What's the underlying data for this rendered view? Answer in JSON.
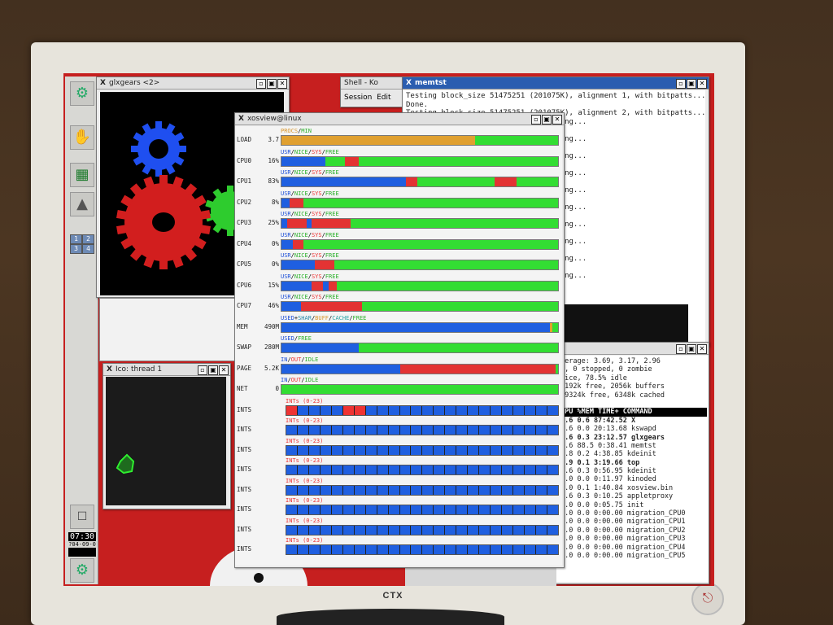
{
  "monitor": {
    "brand": "CTX"
  },
  "panel": {
    "pager": [
      "1",
      "2",
      "3",
      "4"
    ],
    "clock_time": "07:30",
    "clock_date": "?04-09-0"
  },
  "glxgears": {
    "title": "glxgears <2>"
  },
  "ico": {
    "title": "Ico: thread 1"
  },
  "shell": {
    "title": "Shell - Ko",
    "menu": [
      "Session",
      "Edit"
    ]
  },
  "memtst": {
    "title": "memtst",
    "lines": [
      "Testing block_size 51475251 (201075K), alignment 1, with bitpatts...Verifying...",
      "Done.",
      "Testing block_size 51475251 (201075K), alignment 2, with bitpatts...Verifying...",
      "                                        alignment 3, with bitpatts...Verifying...",
      "",
      "                                        alignment 0, with bitpatts...Verifying...",
      "",
      "                                        alignment 1, with bitpatts...Verifying...",
      "",
      "                                        alignment 2, with bitpatts...Verifying...",
      "",
      "                                        alignment 3, with bitpatts...Verifying...",
      "",
      "                                        alignment 0, with bitpatts...Verifying...",
      "",
      "                                        alignment 1, with bitpatts...Verifying...",
      "",
      "                                        alignment 2, with bitpatts...Verifying...",
      "",
      "                                        alignment 3, with bitpatts...Verifying...",
      "",
      "                                        alignment 0, with bitpatts...Verifying..."
    ]
  },
  "top": {
    "summary": [
      "verage: 3.69, 3.17, 2.96",
      "g,    0 stopped,    0 zombie",
      " nice,  78.5% idle",
      "  5192k free,    2056k buffers",
      "29324k free,    6348k cached"
    ],
    "header": "CPU %MEM   TIME+  COMMAND",
    "rows": [
      {
        "cpu": "1.6",
        "mem": "0.6",
        "time": "87:42.52",
        "cmd": "X",
        "bold": true
      },
      {
        "cpu": "1.6",
        "mem": "0.0",
        "time": "20:13.68",
        "cmd": "kswapd",
        "bold": false
      },
      {
        "cpu": "2.6",
        "mem": "0.3",
        "time": "23:12.57",
        "cmd": "glxgears",
        "bold": true
      },
      {
        "cpu": "2.6",
        "mem": "88.5",
        "time": "0:38.41",
        "cmd": "memtst",
        "bold": false
      },
      {
        "cpu": "4.8",
        "mem": "0.2",
        "time": "4:38.85",
        "cmd": "kdeinit",
        "bold": false
      },
      {
        "cpu": "2.9",
        "mem": "0.1",
        "time": "3:19.66",
        "cmd": "top",
        "bold": true
      },
      {
        "cpu": "1.6",
        "mem": "0.3",
        "time": "0:56.95",
        "cmd": "kdeinit",
        "bold": false
      },
      {
        "cpu": "0.0",
        "mem": "0.0",
        "time": "0:11.97",
        "cmd": "kinoded",
        "bold": false
      },
      {
        "cpu": "1.0",
        "mem": "0.1",
        "time": "1:40.84",
        "cmd": "xosview.bin",
        "bold": false
      },
      {
        "cpu": "0.6",
        "mem": "0.3",
        "time": "0:10.25",
        "cmd": "appletproxy",
        "bold": false
      },
      {
        "cpu": "0.0",
        "mem": "0.0",
        "time": "0:05.75",
        "cmd": "init",
        "bold": false
      },
      {
        "cpu": "0.0",
        "mem": "0.0",
        "time": "0:00.00",
        "cmd": "migration_CPU0",
        "bold": false
      },
      {
        "cpu": "0.0",
        "mem": "0.0",
        "time": "0:00.00",
        "cmd": "migration_CPU1",
        "bold": false
      },
      {
        "cpu": "0.0",
        "mem": "0.0",
        "time": "0:00.00",
        "cmd": "migration_CPU2",
        "bold": false
      },
      {
        "cpu": "0.0",
        "mem": "0.0",
        "time": "0:00.00",
        "cmd": "migration_CPU3",
        "bold": false
      },
      {
        "cpu": "0.0",
        "mem": "0.0",
        "time": "0:00.00",
        "cmd": "migration_CPU4",
        "bold": false
      },
      {
        "cpu": "0.0",
        "mem": "0.0",
        "time": "0:00.00",
        "cmd": "migration_CPU5",
        "bold": false
      }
    ]
  },
  "xosview": {
    "title": "xosview@linux",
    "colors": {
      "usr": "#1f5fe0",
      "nice": "#33dd33",
      "sys": "#e33333",
      "free": "#33dd33",
      "procs": "#e0a030",
      "buff": "#e0a030",
      "cache": "#2ab5b5",
      "shar": "#2a8aaa"
    },
    "meters": [
      {
        "name": "LOAD",
        "value": "3.7",
        "legend": [
          [
            "PROCS",
            "procs"
          ],
          [
            "/",
            ""
          ],
          [
            "MIN",
            "min"
          ]
        ],
        "segments": [
          [
            "procs",
            0.7
          ],
          [
            "free",
            0.3
          ]
        ]
      },
      {
        "name": "CPU0",
        "value": "16%",
        "legend": [
          [
            "USR",
            "usr"
          ],
          [
            "/",
            ""
          ],
          [
            "NICE",
            "nice"
          ],
          [
            "/",
            ""
          ],
          [
            "SYS",
            "sys"
          ],
          [
            "/",
            ""
          ],
          [
            "FREE",
            "free"
          ]
        ],
        "segments": [
          [
            "usr",
            0.16
          ],
          [
            "nice",
            0.07
          ],
          [
            "sys",
            0.05
          ],
          [
            "free",
            0.72
          ]
        ]
      },
      {
        "name": "CPU1",
        "value": "83%",
        "legend": [
          [
            "USR",
            "usr"
          ],
          [
            "/",
            ""
          ],
          [
            "NICE",
            "nice"
          ],
          [
            "/",
            ""
          ],
          [
            "SYS",
            "sys"
          ],
          [
            "/",
            ""
          ],
          [
            "FREE",
            "free"
          ]
        ],
        "segments": [
          [
            "usr",
            0.45
          ],
          [
            "sys",
            0.04
          ],
          [
            "nice",
            0.28
          ],
          [
            "sys",
            0.08
          ],
          [
            "free",
            0.15
          ]
        ]
      },
      {
        "name": "CPU2",
        "value": "8%",
        "legend": [
          [
            "USR",
            "usr"
          ],
          [
            "/",
            ""
          ],
          [
            "NICE",
            "nice"
          ],
          [
            "/",
            ""
          ],
          [
            "SYS",
            "sys"
          ],
          [
            "/",
            ""
          ],
          [
            "FREE",
            "free"
          ]
        ],
        "segments": [
          [
            "usr",
            0.03
          ],
          [
            "sys",
            0.05
          ],
          [
            "free",
            0.92
          ]
        ]
      },
      {
        "name": "CPU3",
        "value": "25%",
        "legend": [
          [
            "USR",
            "usr"
          ],
          [
            "/",
            ""
          ],
          [
            "NICE",
            "nice"
          ],
          [
            "/",
            ""
          ],
          [
            "SYS",
            "sys"
          ],
          [
            "/",
            ""
          ],
          [
            "FREE",
            "free"
          ]
        ],
        "segments": [
          [
            "usr",
            0.02
          ],
          [
            "sys",
            0.07
          ],
          [
            "usr",
            0.02
          ],
          [
            "sys",
            0.14
          ],
          [
            "free",
            0.75
          ]
        ]
      },
      {
        "name": "CPU4",
        "value": "0%",
        "legend": [
          [
            "USR",
            "usr"
          ],
          [
            "/",
            ""
          ],
          [
            "NICE",
            "nice"
          ],
          [
            "/",
            ""
          ],
          [
            "SYS",
            "sys"
          ],
          [
            "/",
            ""
          ],
          [
            "FREE",
            "free"
          ]
        ],
        "segments": [
          [
            "usr",
            0.04
          ],
          [
            "sys",
            0.04
          ],
          [
            "free",
            0.92
          ]
        ]
      },
      {
        "name": "CPU5",
        "value": "0%",
        "legend": [
          [
            "USR",
            "usr"
          ],
          [
            "/",
            ""
          ],
          [
            "NICE",
            "nice"
          ],
          [
            "/",
            ""
          ],
          [
            "SYS",
            "sys"
          ],
          [
            "/",
            ""
          ],
          [
            "FREE",
            "free"
          ]
        ],
        "segments": [
          [
            "usr",
            0.12
          ],
          [
            "sys",
            0.07
          ],
          [
            "free",
            0.81
          ]
        ]
      },
      {
        "name": "CPU6",
        "value": "15%",
        "legend": [
          [
            "USR",
            "usr"
          ],
          [
            "/",
            ""
          ],
          [
            "NICE",
            "nice"
          ],
          [
            "/",
            ""
          ],
          [
            "SYS",
            "sys"
          ],
          [
            "/",
            ""
          ],
          [
            "FREE",
            "free"
          ]
        ],
        "segments": [
          [
            "usr",
            0.11
          ],
          [
            "sys",
            0.04
          ],
          [
            "usr",
            0.02
          ],
          [
            "sys",
            0.03
          ],
          [
            "free",
            0.8
          ]
        ]
      },
      {
        "name": "CPU7",
        "value": "46%",
        "legend": [
          [
            "USR",
            "usr"
          ],
          [
            "/",
            ""
          ],
          [
            "NICE",
            "nice"
          ],
          [
            "/",
            ""
          ],
          [
            "SYS",
            "sys"
          ],
          [
            "/",
            ""
          ],
          [
            "FREE",
            "free"
          ]
        ],
        "segments": [
          [
            "usr",
            0.07
          ],
          [
            "sys",
            0.22
          ],
          [
            "nice",
            0.17
          ],
          [
            "free",
            0.54
          ]
        ]
      },
      {
        "name": "MEM",
        "value": "490M",
        "legend": [
          [
            "USED",
            "used"
          ],
          [
            "+",
            ""
          ],
          [
            "SHAR",
            "shar"
          ],
          [
            "/",
            ""
          ],
          [
            "BUFF",
            "buff"
          ],
          [
            "/",
            ""
          ],
          [
            "CACHE",
            "cache"
          ],
          [
            "/",
            ""
          ],
          [
            "FREE",
            "free"
          ]
        ],
        "segments": [
          [
            "usr",
            0.97
          ],
          [
            "buff",
            0.01
          ],
          [
            "free",
            0.02
          ]
        ]
      },
      {
        "name": "SWAP",
        "value": "280M",
        "legend": [
          [
            "USED",
            "used"
          ],
          [
            "/",
            ""
          ],
          [
            "FREE",
            "free"
          ]
        ],
        "segments": [
          [
            "usr",
            0.28
          ],
          [
            "free",
            0.72
          ]
        ]
      },
      {
        "name": "PAGE",
        "value": "5.2K",
        "legend": [
          [
            "IN",
            "in"
          ],
          [
            "/",
            ""
          ],
          [
            "OUT",
            "out"
          ],
          [
            "/",
            ""
          ],
          [
            "IDLE",
            "idle"
          ]
        ],
        "segments": [
          [
            "usr",
            0.43
          ],
          [
            "sys",
            0.56
          ],
          [
            "free",
            0.01
          ]
        ]
      },
      {
        "name": "NET",
        "value": "0",
        "legend": [
          [
            "IN",
            "in"
          ],
          [
            "/",
            ""
          ],
          [
            "OUT",
            "out"
          ],
          [
            "/",
            ""
          ],
          [
            "IDLE",
            "idle"
          ]
        ],
        "segments": [
          [
            "free",
            1.0
          ]
        ]
      }
    ],
    "ints": [
      {
        "name": "INTS",
        "legend": "INTs (0-23)",
        "hot": [
          0,
          5,
          6
        ]
      },
      {
        "name": "INTS",
        "legend": "INTs (0-23)",
        "hot": []
      },
      {
        "name": "INTS",
        "legend": "INTs (0-23)",
        "hot": []
      },
      {
        "name": "INTS",
        "legend": "INTs (0-23)",
        "hot": []
      },
      {
        "name": "INTS",
        "legend": "INTs (0-23)",
        "hot": []
      },
      {
        "name": "INTS",
        "legend": "INTs (0-23)",
        "hot": []
      },
      {
        "name": "INTS",
        "legend": "INTs (0-23)",
        "hot": []
      },
      {
        "name": "INTS",
        "legend": "INTs (0-23)",
        "hot": []
      }
    ],
    "int_count": 24
  }
}
